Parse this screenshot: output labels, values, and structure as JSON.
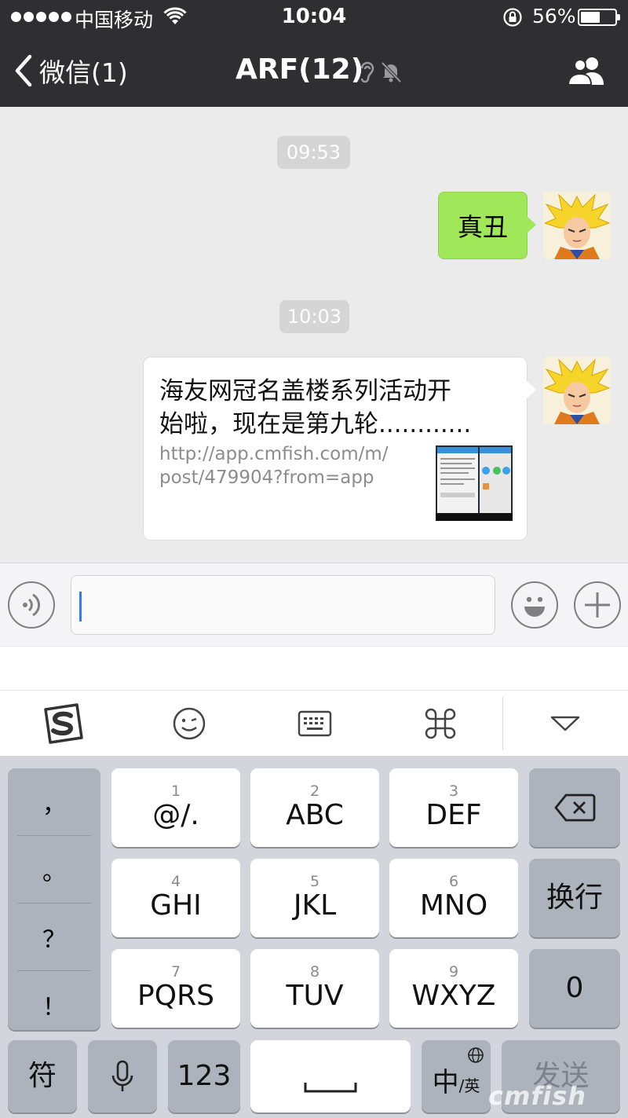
{
  "status_bar": {
    "carrier": "中国移动",
    "time": "10:04",
    "battery_percent": "56%",
    "battery_level": 0.56
  },
  "nav": {
    "back_label": "微信(1)",
    "title": "ARF(12)"
  },
  "chat": {
    "timestamps": [
      "09:53",
      "10:03"
    ],
    "messages": [
      {
        "type": "text",
        "text": "真丑"
      },
      {
        "type": "link",
        "title_line1": "海友网冠名盖楼系列活动开",
        "title_line2": "始啦，现在是第九轮............",
        "url_line1": "http://app.cmfish.com/m/",
        "url_line2": "post/479904?from=app"
      }
    ]
  },
  "input": {
    "value": ""
  },
  "keyboard": {
    "punctuation": [
      "，",
      "。",
      "？",
      "！"
    ],
    "keys": [
      {
        "num": "1",
        "label": "@/."
      },
      {
        "num": "2",
        "label": "ABC"
      },
      {
        "num": "3",
        "label": "DEF"
      },
      {
        "num": "4",
        "label": "GHI"
      },
      {
        "num": "5",
        "label": "JKL"
      },
      {
        "num": "6",
        "label": "MNO"
      },
      {
        "num": "7",
        "label": "PQRS"
      },
      {
        "num": "8",
        "label": "TUV"
      },
      {
        "num": "9",
        "label": "WXYZ"
      }
    ],
    "newline": "换行",
    "zero": "0",
    "symbols": "符",
    "numbers": "123",
    "lang_main": "中",
    "lang_sub": "/英",
    "send": "发送"
  },
  "watermark": "cmfish",
  "colors": {
    "nav_bg": "#2f2f33",
    "chat_bg": "#ebebeb",
    "bubble_green": "#a0e75a",
    "caret": "#2f7cf6",
    "keyboard_bg": "#d2d5db"
  },
  "icons": [
    "back-chevron-icon",
    "wifi-icon",
    "orientation-lock-icon",
    "battery-icon",
    "earpiece-icon",
    "mute-bell-icon",
    "group-members-icon",
    "voice-icon",
    "emoji-icon",
    "plus-icon",
    "sogou-logo-icon",
    "emoticon-icon",
    "keyboard-icon",
    "command-icon",
    "collapse-icon",
    "backspace-icon",
    "microphone-icon",
    "globe-icon"
  ]
}
